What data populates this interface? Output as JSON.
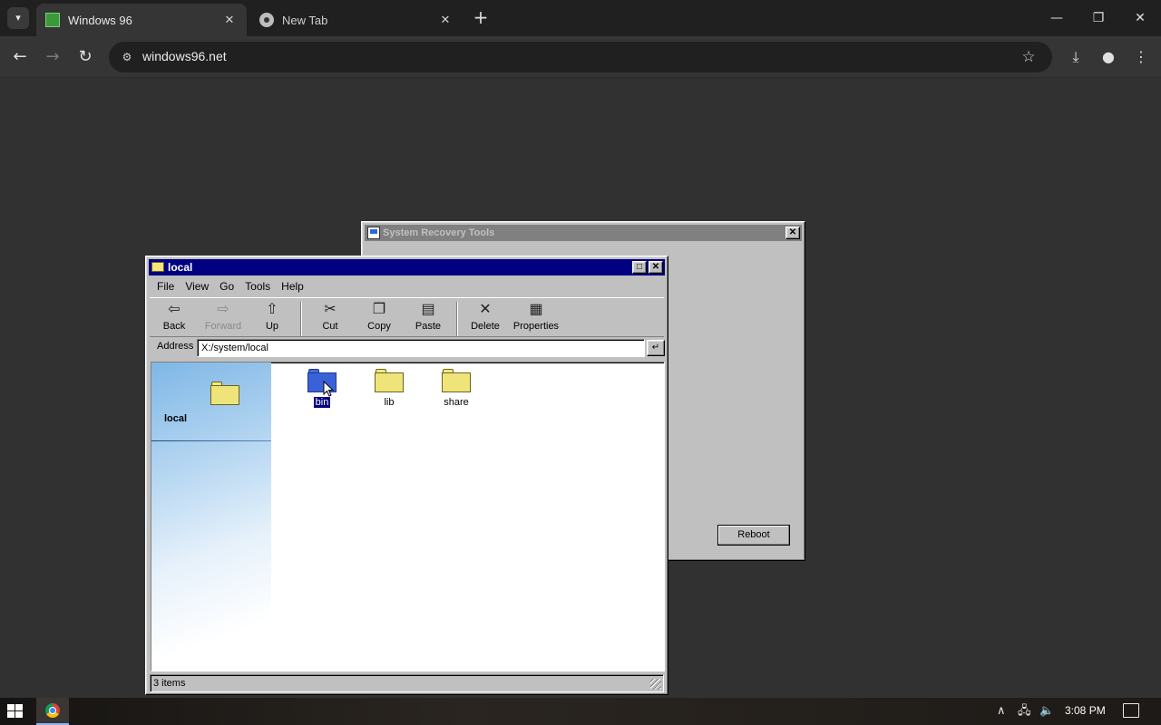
{
  "browser": {
    "tabs": [
      {
        "title": "Windows 96",
        "active": true
      },
      {
        "title": "New Tab",
        "active": false
      }
    ],
    "url": "windows96.net",
    "window_controls": {
      "minimize": "—",
      "restore": "❐",
      "close": "✕"
    }
  },
  "recovery_window": {
    "title": "System Recovery Tools",
    "close_glyph": "✕",
    "reboot_label": "Reboot"
  },
  "explorer": {
    "title": "local",
    "menu": [
      "File",
      "View",
      "Go",
      "Tools",
      "Help"
    ],
    "toolbar": {
      "back": "Back",
      "forward": "Forward",
      "up": "Up",
      "cut": "Cut",
      "copy": "Copy",
      "paste": "Paste",
      "delete": "Delete",
      "properties": "Properties"
    },
    "address_label": "Address",
    "address_value": "X:/system/local",
    "side_title": "local",
    "items": [
      {
        "name": "bin",
        "selected": true,
        "color": "#3a62d8"
      },
      {
        "name": "lib",
        "selected": false,
        "color": "#efe47a"
      },
      {
        "name": "share",
        "selected": false,
        "color": "#efe47a"
      }
    ],
    "status": "3 items"
  },
  "taskbar": {
    "time": "3:08 PM"
  }
}
